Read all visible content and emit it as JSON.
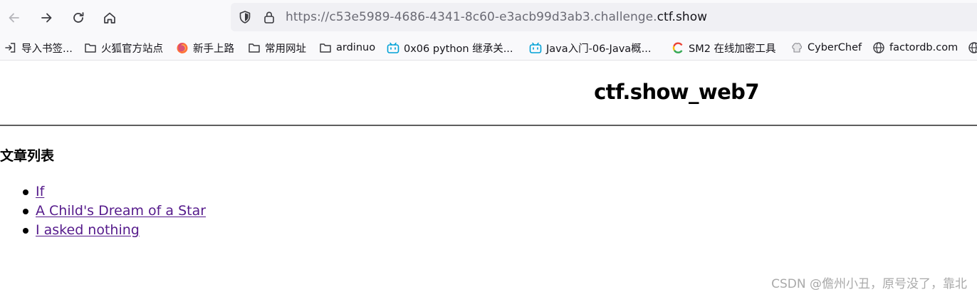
{
  "browser": {
    "url_prefix": "https://c53e5989-4686-4341-8c60-e3acb99d3ab3.challenge.",
    "url_host": "ctf.show"
  },
  "bookmarks": [
    {
      "label": "导入书签...",
      "icon": "import-icon"
    },
    {
      "label": "火狐官方站点",
      "icon": "folder-icon"
    },
    {
      "label": "新手上路",
      "icon": "firefox-icon"
    },
    {
      "label": "常用网址",
      "icon": "folder-icon"
    },
    {
      "label": "ardinuo",
      "icon": "folder-icon"
    },
    {
      "label": "0x06 python 继承关...",
      "icon": "bilibili-icon"
    },
    {
      "label": "Java入门-06-Java概...",
      "icon": "bilibili-icon"
    },
    {
      "label": "SM2 在线加密工具",
      "icon": "colorful-c-icon"
    },
    {
      "label": "CyberChef",
      "icon": "chef-hat-icon"
    },
    {
      "label": "factordb.com",
      "icon": "globe-icon"
    },
    {
      "label": "",
      "icon": "globe-icon"
    }
  ],
  "page": {
    "site_title": "ctf.show_web7",
    "section_title": "文章列表",
    "articles": [
      "If",
      "A Child's Dream of a Star",
      "I asked nothing"
    ]
  },
  "watermark": "CSDN @儋州小丑，原号没了，靠北",
  "colors": {
    "visited_link": "#551a8b",
    "toolbar_bg": "#f9f9fb",
    "urlbar_bg": "#f0f0f4",
    "bilibili": "#00a1d6"
  }
}
